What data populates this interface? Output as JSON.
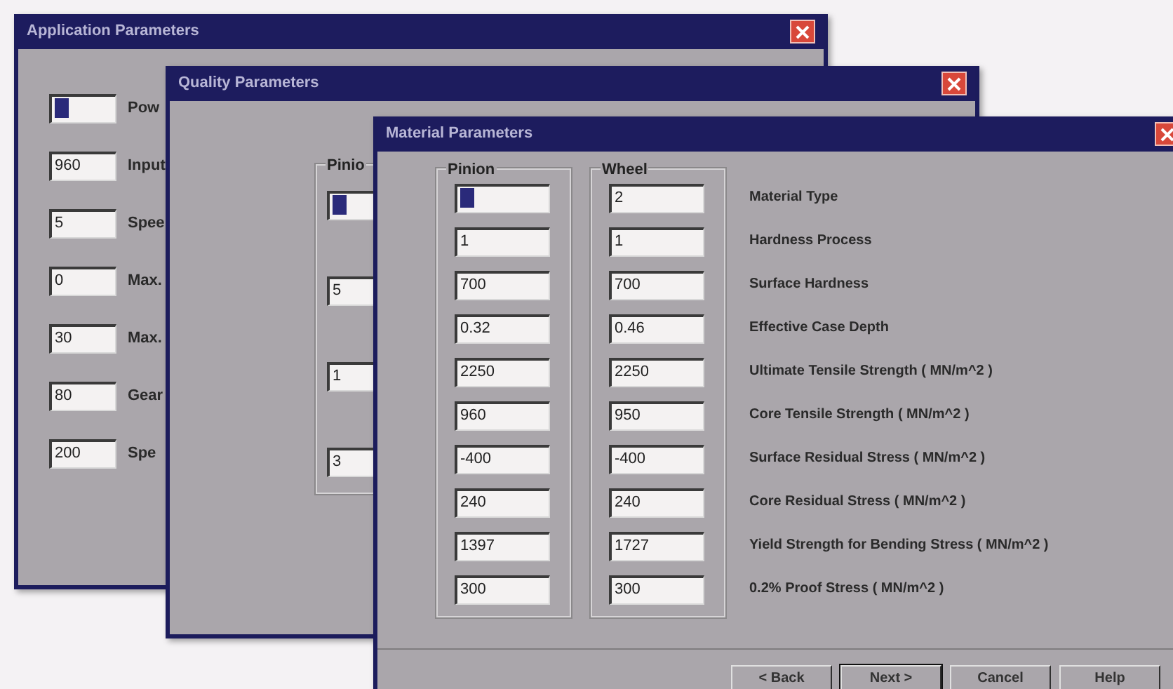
{
  "windows": [
    {
      "kind": "simple",
      "title": "Application Parameters",
      "fields": [
        {
          "selected": true,
          "label": "Pow"
        },
        {
          "selected": false,
          "value": "960",
          "label": "Input"
        },
        {
          "selected": false,
          "value": "5",
          "label": "Spee"
        },
        {
          "selected": false,
          "value": "0",
          "label": "Max."
        },
        {
          "selected": false,
          "value": "30",
          "label": "Max."
        },
        {
          "selected": false,
          "value": "80",
          "label": "Gear"
        },
        {
          "selected": false,
          "value": "200",
          "label": "Spe"
        }
      ]
    },
    {
      "kind": "group",
      "title": "Quality Parameters",
      "group_label": "Pinio",
      "fields": [
        {
          "selected": true
        },
        {
          "selected": false,
          "value": "5"
        },
        {
          "selected": false,
          "value": "1"
        },
        {
          "selected": false,
          "value": "3"
        }
      ]
    },
    {
      "kind": "table",
      "title": "Material Parameters",
      "columns": [
        "Pinion",
        "Wheel"
      ],
      "rows": [
        {
          "pinion": {
            "selected": true
          },
          "wheel": {
            "value": "2",
            "selected": false
          },
          "label": "Material Type"
        },
        {
          "pinion": {
            "value": "1",
            "selected": false
          },
          "wheel": {
            "value": "1",
            "selected": false
          },
          "label": "Hardness Process"
        },
        {
          "pinion": {
            "value": "700",
            "selected": false
          },
          "wheel": {
            "value": "700",
            "selected": false
          },
          "label": "Surface Hardness"
        },
        {
          "pinion": {
            "value": "0.32",
            "selected": false
          },
          "wheel": {
            "value": "0.46",
            "selected": false
          },
          "label": "Effective Case Depth"
        },
        {
          "pinion": {
            "value": "2250",
            "selected": false
          },
          "wheel": {
            "value": "2250",
            "selected": false
          },
          "label": "Ultimate Tensile Strength ( MN/m^2 )"
        },
        {
          "pinion": {
            "value": "960",
            "selected": false
          },
          "wheel": {
            "value": "950",
            "selected": false
          },
          "label": "Core Tensile Strength ( MN/m^2 )"
        },
        {
          "pinion": {
            "value": "-400",
            "selected": false
          },
          "wheel": {
            "value": "-400",
            "selected": false
          },
          "label": "Surface Residual Stress ( MN/m^2 )"
        },
        {
          "pinion": {
            "value": "240",
            "selected": false
          },
          "wheel": {
            "value": "240",
            "selected": false
          },
          "label": "Core Residual Stress ( MN/m^2 )"
        },
        {
          "pinion": {
            "value": "1397",
            "selected": false
          },
          "wheel": {
            "value": "1727",
            "selected": false
          },
          "label": "Yield Strength for Bending Stress ( MN/m^2 )"
        },
        {
          "pinion": {
            "value": "300",
            "selected": false
          },
          "wheel": {
            "value": "300",
            "selected": false
          },
          "label": "0.2% Proof Stress ( MN/m^2 )"
        }
      ],
      "buttons": [
        {
          "label": "< Back",
          "default": false
        },
        {
          "label": "Next >",
          "default": true
        },
        {
          "label": "Cancel",
          "default": false
        },
        {
          "label": "Help",
          "default": false
        }
      ]
    }
  ]
}
